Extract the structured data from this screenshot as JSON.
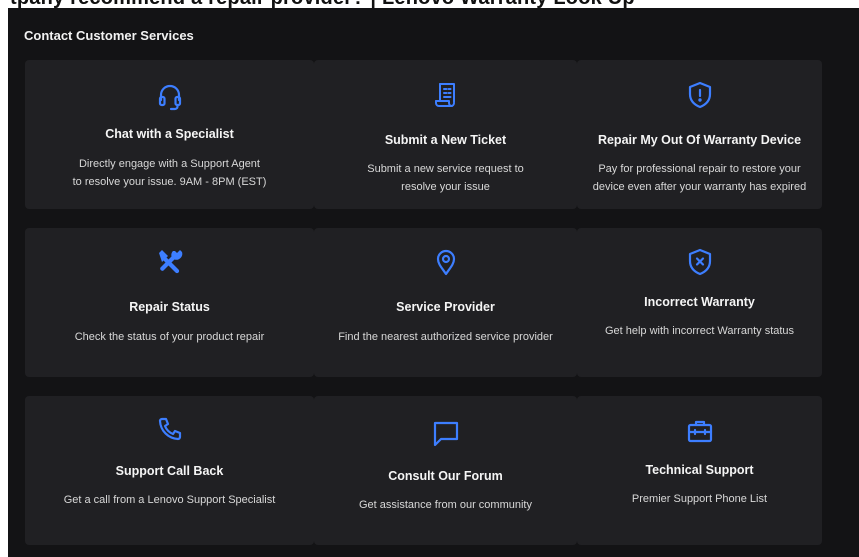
{
  "header": {
    "clipped_heading": "tpany recommend a repair provider? | Lenovo Warranty Look Up"
  },
  "panel": {
    "title": "Contact Customer Services"
  },
  "cards": [
    {
      "icon": "headset-icon",
      "title": "Chat with a Specialist",
      "desc_lines": [
        "Directly engage with a Support Agent",
        "to resolve your issue. 9AM - 8PM (EST)"
      ]
    },
    {
      "icon": "ticket-receipt-icon",
      "title": "Submit a New Ticket",
      "desc_lines": [
        "Submit a new service request to",
        "resolve your issue"
      ]
    },
    {
      "icon": "shield-alert-icon",
      "title": "Repair My Out Of Warranty Device",
      "desc_lines": [
        "Pay for professional repair to restore your",
        "device even after your warranty has expired"
      ]
    },
    {
      "icon": "tools-icon",
      "title": "Repair Status",
      "desc_lines": [
        "Check the status of your product repair"
      ]
    },
    {
      "icon": "map-pin-icon",
      "title": "Service Provider",
      "desc_lines": [
        "Find the nearest authorized service provider"
      ]
    },
    {
      "icon": "shield-x-icon",
      "title": "Incorrect Warranty",
      "desc_lines": [
        "Get help with incorrect Warranty status"
      ]
    },
    {
      "icon": "phone-icon",
      "title": "Support Call Back",
      "desc_lines": [
        "Get a call from a Lenovo Support Specialist"
      ]
    },
    {
      "icon": "chat-bubble-icon",
      "title": "Consult Our Forum",
      "desc_lines": [
        "Get assistance from our community"
      ]
    },
    {
      "icon": "toolbox-icon",
      "title": "Technical Support",
      "desc_lines": [
        "Premier Support Phone List"
      ]
    }
  ],
  "colors": {
    "accent": "#3d7eff",
    "panel_bg": "#131315",
    "card_bg": "#202023"
  }
}
